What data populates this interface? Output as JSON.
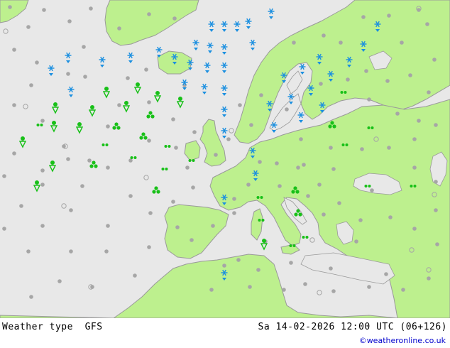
{
  "header": {
    "title": "Weather type",
    "model": "GFS",
    "datetime": "Sa 14-02-2026 12:00 UTC (06+126)"
  },
  "credit": "©weatheronline.co.uk",
  "colors": {
    "sea": "#e8e8e8",
    "land": "#bdf08e",
    "coast": "#9a9a9a",
    "snow": "#1a8fe0",
    "rain": "#18c018",
    "dry": "#a6a6a6"
  },
  "legend_symbols": {
    "snow": "snowflake-icon",
    "rain": "raindrop-icon",
    "shower": "shower-cloud-icon",
    "dry": "dry-dot-icon"
  }
}
